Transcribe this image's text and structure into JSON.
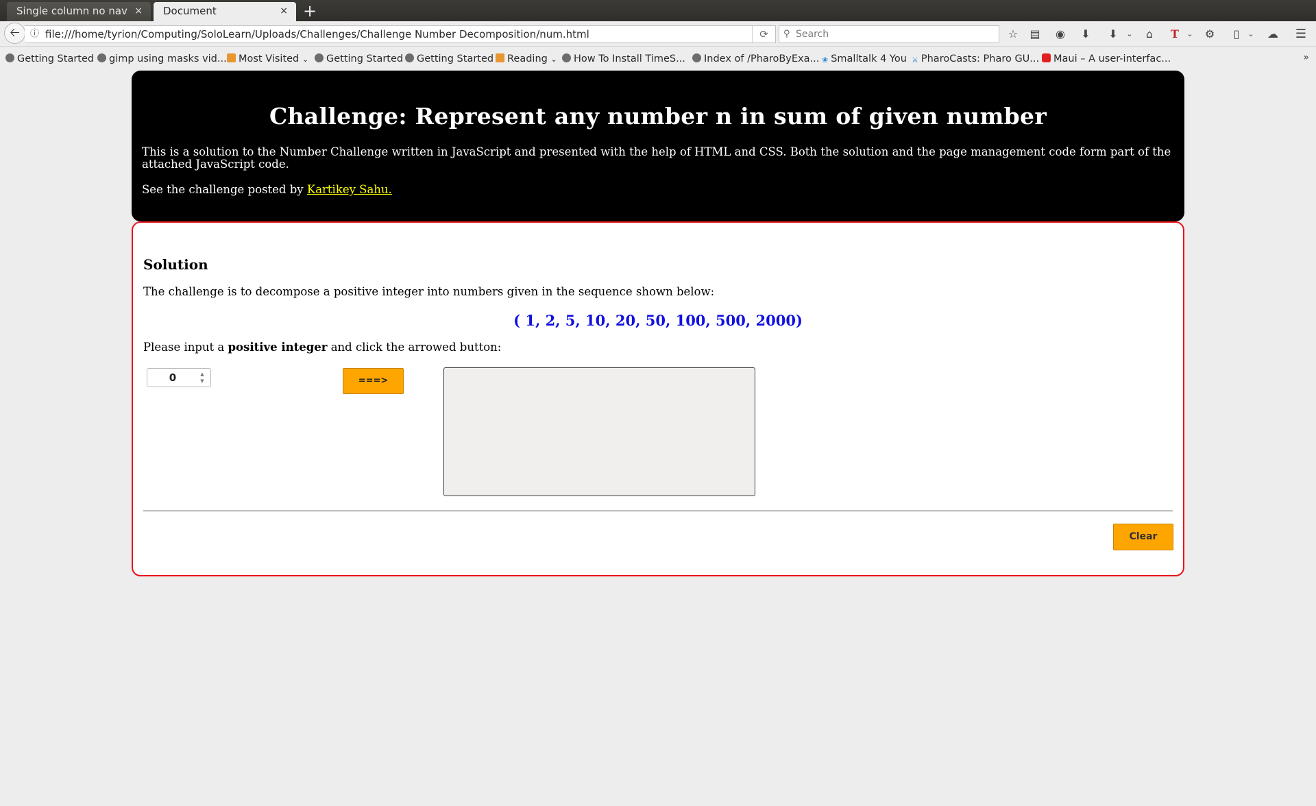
{
  "browser": {
    "tabs": [
      {
        "label": "Single column no nav"
      },
      {
        "label": "Document"
      }
    ],
    "new_tab_label": "+",
    "tab_close_glyph": "×",
    "url": "file:///home/tyrion/Computing/SoloLearn/Uploads/Challenges/Challenge Number Decomposition/num.html",
    "search_placeholder": "Search",
    "bookmarks": [
      {
        "label": "Getting Started",
        "icon": "globe-icon"
      },
      {
        "label": "gimp using masks vid...",
        "icon": "globe-icon"
      },
      {
        "label": "Most Visited",
        "icon": "folder-icon",
        "has_dropdown": true
      },
      {
        "label": "Getting Started",
        "icon": "globe-icon"
      },
      {
        "label": "Getting Started",
        "icon": "globe-icon"
      },
      {
        "label": "Reading",
        "icon": "folder-icon",
        "has_dropdown": true
      },
      {
        "label": "How To Install TimeS...",
        "icon": "globe-icon"
      },
      {
        "label": "Index of /PharoByExa...",
        "icon": "globe-icon"
      },
      {
        "label": "Smalltalk 4 You",
        "icon": "smalltalk-icon"
      },
      {
        "label": "PharoCasts: Pharo GU...",
        "icon": "pharo-icon"
      },
      {
        "label": "Maui – A user-interfac...",
        "icon": "youtube-icon"
      }
    ],
    "bookmarks_overflow": "»"
  },
  "header": {
    "title": "Challenge: Represent any number n in sum of given number",
    "intro": "This is a solution to the Number Challenge written in JavaScript and presented with the help of HTML and CSS. Both the solution and the page management code form part of the attached JavaScript code.",
    "see_prefix": "See the challenge posted by ",
    "author_link": "Kartikey Sahu."
  },
  "solution": {
    "title": "Solution",
    "description": "The challenge is to decompose a positive integer into numbers given in the sequence shown below:",
    "sequence": "( 1, 2, 5, 10, 20, 50, 100, 500, 2000)",
    "prompt_before": "Please input a ",
    "prompt_bold": "positive integer",
    "prompt_after": " and click the arrowed button:",
    "input_value": "0",
    "go_button": "===>",
    "output_text": "",
    "clear_button": "Clear"
  },
  "colors": {
    "header_bg": "#000000",
    "link": "#ffff00",
    "sequence": "#1010e0",
    "border": "#e8141e",
    "button": "#ffa500"
  }
}
